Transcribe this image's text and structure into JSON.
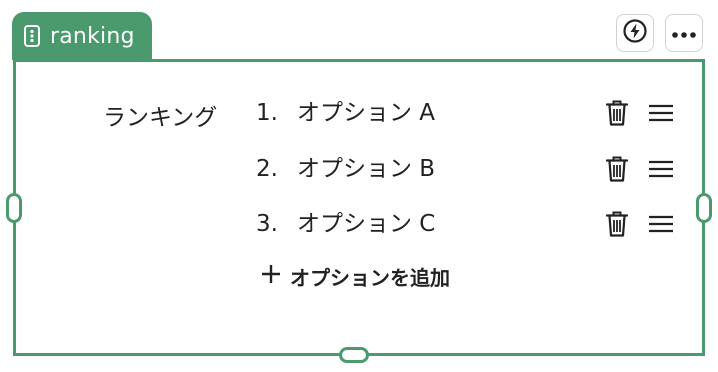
{
  "block": {
    "type_label": "ranking",
    "accent_color": "#4a9a6e"
  },
  "toolbar": {
    "bolt_icon": "lightning-bolt-icon",
    "more_icon": "more-dots-icon"
  },
  "question": {
    "label": "ランキング"
  },
  "options": [
    {
      "number": "1.",
      "text": "オプション A"
    },
    {
      "number": "2.",
      "text": "オプション B"
    },
    {
      "number": "3.",
      "text": "オプション C"
    }
  ],
  "add_option": {
    "label": "オプションを追加"
  }
}
